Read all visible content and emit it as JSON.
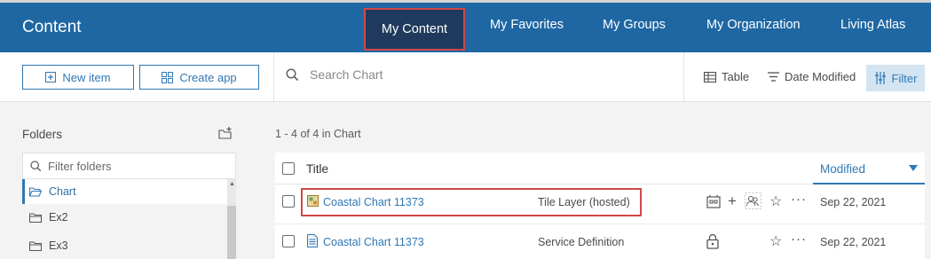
{
  "header": {
    "title": "Content",
    "tabs": [
      "My Content",
      "My Favorites",
      "My Groups",
      "My Organization",
      "Living Atlas"
    ],
    "active_tab": "My Content"
  },
  "toolbar": {
    "new_item": "New item",
    "create_app": "Create app",
    "search_placeholder": "Search Chart",
    "view": "Table",
    "sort": "Date Modified",
    "filter": "Filter"
  },
  "folders": {
    "heading": "Folders",
    "filter_placeholder": "Filter folders",
    "items": [
      "Chart",
      "Ex2",
      "Ex3"
    ],
    "selected": "Chart"
  },
  "results": {
    "count_text": "1 - 4 of 4 in Chart",
    "columns": {
      "title": "Title",
      "modified": "Modified"
    },
    "rows": [
      {
        "title": "Coastal Chart 11373",
        "type": "Tile Layer (hosted)",
        "modified": "Sep 22, 2021",
        "icon": "tile-layer-icon"
      },
      {
        "title": "Coastal Chart 11373",
        "type": "Service Definition",
        "modified": "Sep 22, 2021",
        "icon": "service-definition-icon"
      }
    ]
  },
  "colors": {
    "header_bg": "#1e67a3",
    "active_tab_bg": "#1f3a5c",
    "accent": "#2f78b5",
    "highlight": "#d0474a"
  }
}
